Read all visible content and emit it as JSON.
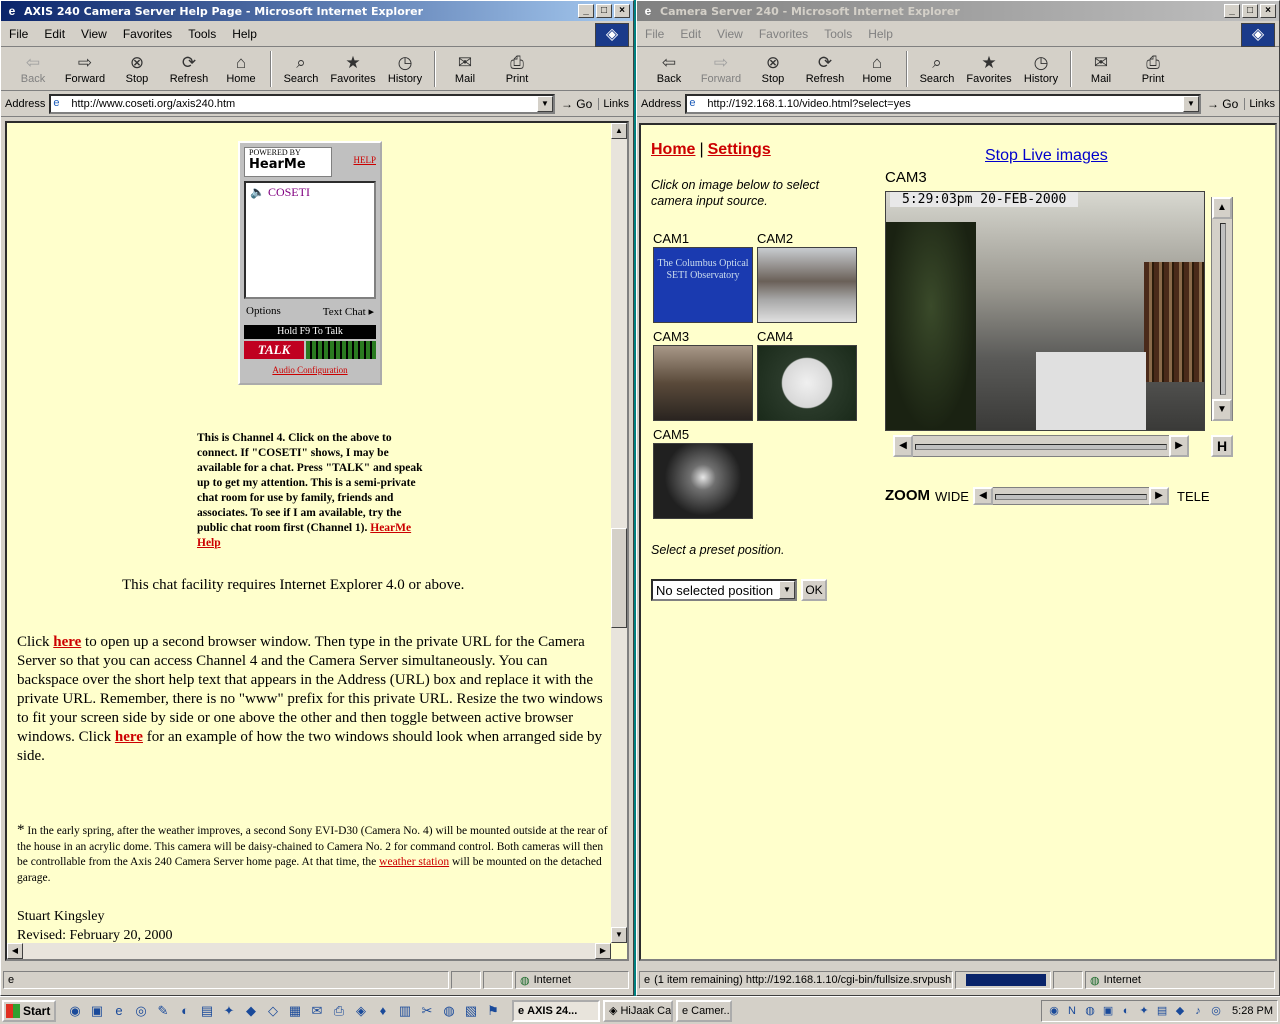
{
  "left_window": {
    "title": "AXIS 240 Camera Server Help Page - Microsoft Internet Explorer",
    "menu": [
      "File",
      "Edit",
      "View",
      "Favorites",
      "Tools",
      "Help"
    ],
    "toolbar": [
      {
        "label": "Back",
        "icon": "back-arrow-icon",
        "disabled": true
      },
      {
        "label": "Forward",
        "icon": "forward-arrow-icon",
        "disabled": false
      },
      {
        "label": "Stop",
        "icon": "stop-icon",
        "disabled": false
      },
      {
        "label": "Refresh",
        "icon": "refresh-icon",
        "disabled": false
      },
      {
        "label": "Home",
        "icon": "home-icon",
        "disabled": false
      },
      {
        "label": "Search",
        "icon": "search-icon",
        "disabled": false
      },
      {
        "label": "Favorites",
        "icon": "favorites-icon",
        "disabled": false
      },
      {
        "label": "History",
        "icon": "history-icon",
        "disabled": false
      },
      {
        "label": "Mail",
        "icon": "mail-icon",
        "disabled": false
      },
      {
        "label": "Print",
        "icon": "print-icon",
        "disabled": false
      }
    ],
    "address_label": "Address",
    "address": "http://www.coseti.org/axis240.htm",
    "go": "Go",
    "links": "Links",
    "hearme": {
      "powered_by": "POWERED BY",
      "brand": "HearMe",
      "help": "HELP",
      "list_item": "COSETI",
      "options": "Options",
      "text_chat": "Text Chat",
      "hold_f9": "Hold F9 To Talk",
      "talk": "TALK",
      "audio_config": "Audio Configuration"
    },
    "channel_text": "This is Channel 4.  Click on the above to connect.  If \"COSETI\" shows, I may be available for a chat.  Press \"TALK\" and speak up to get my attention.  This is a semi-private chat room for use by family, friends and associates.  To see if I am available, try the public chat room first (Channel 1).",
    "hearme_help_link": "HearMe Help",
    "ie_requirement": "This chat facility requires Internet Explorer 4.0 or above.",
    "main_p1": "Click",
    "here1": "here",
    "main_p2": " to open up a second browser window.  Then type in the private URL for the Camera Server so that you can access Channel 4 and the Camera Server simultaneously.  You can backspace over the short help text that appears in the Address (URL) box and replace it with the private URL.  Remember, there is no \"www\" prefix for this private URL.  Resize the two windows to fit your screen side by side or one above the other and then toggle between active browser windows.  Click ",
    "here2": "here",
    "main_p3": " for an example of how the two windows should look when arranged side by side.",
    "note_star": "*",
    "note_text1": " In the early spring, after the weather improves, a second Sony EVI-D30 (Camera No. 4) will be mounted outside at the rear of the house in an acrylic dome.  This camera will be daisy-chained to Camera No. 2 for command control.  Both cameras will then be controllable from the Axis 240 Camera Server home page.  At that time, the ",
    "weather_link": "weather station",
    "note_text2": " will be mounted on the detached garage.",
    "signature": "Stuart Kingsley",
    "revised": "Revised: February 20, 2000",
    "status_zone": "Internet"
  },
  "right_window": {
    "title": "Camera Server 240 - Microsoft Internet Explorer",
    "menu": [
      "File",
      "Edit",
      "View",
      "Favorites",
      "Tools",
      "Help"
    ],
    "toolbar": [
      {
        "label": "Back",
        "icon": "back-arrow-icon",
        "disabled": false
      },
      {
        "label": "Forward",
        "icon": "forward-arrow-icon",
        "disabled": true
      },
      {
        "label": "Stop",
        "icon": "stop-icon",
        "disabled": false
      },
      {
        "label": "Refresh",
        "icon": "refresh-icon",
        "disabled": false
      },
      {
        "label": "Home",
        "icon": "home-icon",
        "disabled": false
      },
      {
        "label": "Search",
        "icon": "search-icon",
        "disabled": false
      },
      {
        "label": "Favorites",
        "icon": "favorites-icon",
        "disabled": false
      },
      {
        "label": "History",
        "icon": "history-icon",
        "disabled": false
      },
      {
        "label": "Mail",
        "icon": "mail-icon",
        "disabled": false
      },
      {
        "label": "Print",
        "icon": "print-icon",
        "disabled": false
      }
    ],
    "address_label": "Address",
    "address": "http://192.168.1.10/video.html?select=yes",
    "go": "Go",
    "links": "Links",
    "nav_home": "Home",
    "nav_sep": "|",
    "nav_settings": "Settings",
    "instructions": "Click on image below to select camera input source.",
    "cameras": [
      "CAM1",
      "CAM2",
      "CAM3",
      "CAM4",
      "CAM5"
    ],
    "cam1_text": "The Columbus Optical SETI Observatory",
    "stop_live": "Stop Live images",
    "current_cam": "CAM3",
    "timestamp": "5:29:03pm 20-FEB-2000",
    "zoom_label": "ZOOM",
    "wide_label": "WIDE",
    "tele_label": "TELE",
    "h_button": "H",
    "preset_label": "Select a preset position.",
    "preset_value": "No selected position",
    "ok": "OK",
    "status_text": "(1 item remaining) http://192.168.1.10/cgi-bin/fullsize.srvpush",
    "status_zone": "Internet"
  },
  "taskbar": {
    "start": "Start",
    "tasks": [
      "AXIS 24...",
      "HiJaak Ca...",
      "Camer..."
    ],
    "clock": "5:28 PM"
  }
}
